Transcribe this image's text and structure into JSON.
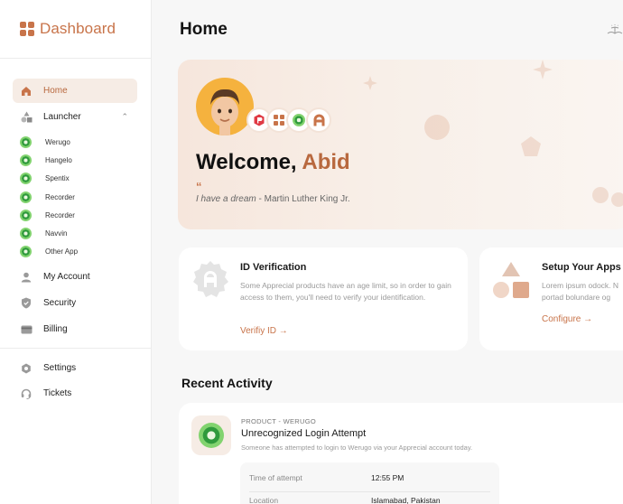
{
  "sidebar": {
    "logo_text": "Dashboard",
    "items": [
      {
        "label": "Home",
        "icon": "home-icon",
        "active": true
      },
      {
        "label": "Launcher",
        "icon": "shapes-icon"
      },
      {
        "label": "My Account",
        "icon": "user-icon"
      },
      {
        "label": "Security",
        "icon": "shield-icon"
      },
      {
        "label": "Billing",
        "icon": "card-icon"
      },
      {
        "label": "Settings",
        "icon": "gear-icon"
      },
      {
        "label": "Tickets",
        "icon": "headset-icon"
      }
    ],
    "apps": [
      "Werugo",
      "Hangelo",
      "Spentix",
      "Recorder",
      "Recorder",
      "Navvin",
      "Other App"
    ]
  },
  "header": {
    "title": "Home"
  },
  "welcome": {
    "greeting": "Welcome,",
    "name": "Abid",
    "quote_mark": "“",
    "quote_text": "I have a dream",
    "quote_author": "- Martin Luther King Jr."
  },
  "cards": {
    "id_verification": {
      "title": "ID Verification",
      "desc": "Some Apprecial products have an age limit, so in order to gain access to them, you'll need to verify your identification.",
      "link": "Verifiy ID →"
    },
    "setup_apps": {
      "title": "Setup Your Apps",
      "desc": "Lorem ipsum odock. N portad bolundare og",
      "link": "Configure →"
    }
  },
  "activity": {
    "section_title": "Recent Activity",
    "item": {
      "label": "PRODUCT - WERUGO",
      "title": "Unrecognized Login Attempt",
      "desc": "Someone has attempted to login to Werugo via your Apprecial account today.",
      "rows": [
        {
          "key": "Time of attempt",
          "value": "12:55 PM"
        },
        {
          "key": "Location",
          "value": "Islamabad, Pakistan"
        }
      ]
    }
  },
  "colors": {
    "accent": "#c8744a",
    "active_bg": "#f6ece5",
    "app_green": "#2f9a3c"
  }
}
